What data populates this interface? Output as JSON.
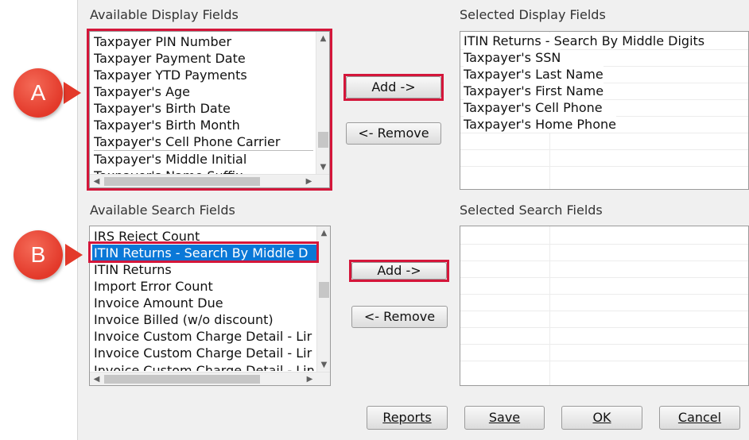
{
  "display": {
    "available_label": "Available Display Fields",
    "selected_label": "Selected Display Fields",
    "available_items": [
      "Taxpayer PIN Number",
      "Taxpayer Payment Date",
      "Taxpayer YTD Payments",
      "Taxpayer's Age",
      "Taxpayer's Birth Date",
      "Taxpayer's Birth Month",
      "Taxpayer's Cell Phone Carrier",
      "Taxpayer's Middle Initial",
      "Taxpayer's Name Suffix"
    ],
    "selected_items": [
      "ITIN Returns - Search By Middle Digits",
      "Taxpayer's SSN",
      "Taxpayer's Last Name",
      "Taxpayer's First Name",
      "Taxpayer's Cell Phone",
      "Taxpayer's Home Phone"
    ],
    "add_label": "Add ->",
    "remove_label": "<- Remove"
  },
  "search": {
    "available_label": "Available Search Fields",
    "selected_label": "Selected Search Fields",
    "available_items": [
      "IRS Reject Count",
      "ITIN Returns - Search By Middle D",
      "ITIN Returns",
      "Import Error Count",
      "Invoice Amount Due",
      "Invoice Billed (w/o discount)",
      "Invoice Custom Charge Detail - Lir",
      "Invoice Custom Charge Detail - Lir",
      "Invoice Custom Charge Detail - Lin"
    ],
    "selected_index": 1,
    "add_label": "Add ->",
    "remove_label": "<- Remove"
  },
  "footer": {
    "reports_label": "Reports",
    "save_label": "Save",
    "ok_label": "OK",
    "cancel_label": "Cancel"
  },
  "callouts": {
    "a": "A",
    "b": "B",
    "color": "#e3392a",
    "highlight_color": "#d4163a"
  },
  "colors": {
    "selection": "#0a78d7",
    "panel": "#f0f0f0"
  }
}
